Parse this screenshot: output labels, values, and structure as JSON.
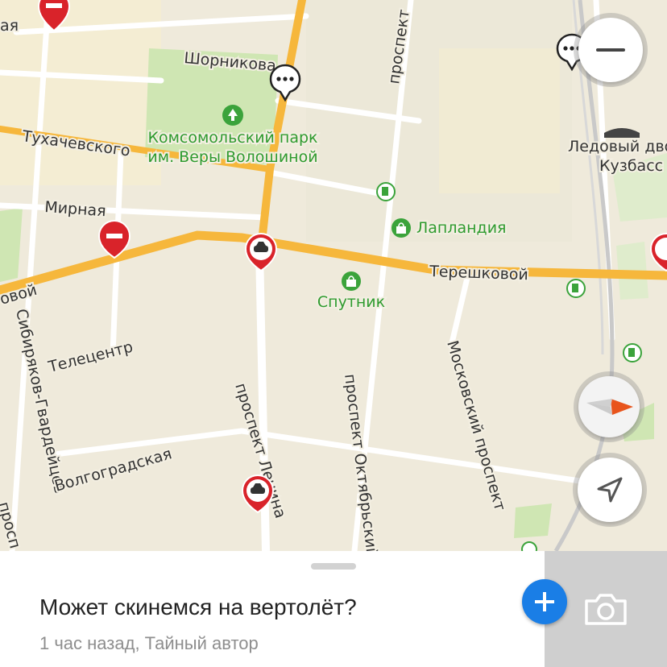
{
  "map": {
    "streets": {
      "shornikova": "Шорникова",
      "tukhachevskogo": "Тухачевского",
      "mirnaya": "Мирная",
      "tereshkovoy": "Терешковой",
      "ovoy": "овой",
      "telecentr": "Телецентр",
      "sibiryakov": "Сибиряков-Гвардейцев",
      "volgogradskaya": "Волгоградская",
      "prospekt_lenina": "проспект Ленина",
      "prospekt_oktyabrsky": "проспект Октябрьский",
      "moskovsky_prospekt": "Московский проспект",
      "prospekt_top": "проспект",
      "prosp_left": "просп",
      "aya": "ая"
    },
    "pois": {
      "park_line1": "Комсомольский парк",
      "park_line2": "им. Веры Волошиной",
      "laplandiya": "Лапландия",
      "sputnik": "Спутник",
      "ice_palace_line1": "Ледовый двор",
      "ice_palace_line2": "Кузбасс"
    },
    "colors": {
      "main_road": "#f6b73c",
      "poi_text": "#2f9b2f",
      "incident_red": "#d9232a"
    }
  },
  "controls": {
    "zoom_out_icon": "minus-icon",
    "compass_icon": "compass-icon",
    "locate_icon": "navigation-arrow-icon"
  },
  "sheet": {
    "title": "Может скинемся на вертолёт?",
    "meta": "1 час назад, Тайный автор",
    "add_icon": "plus-icon",
    "camera_icon": "camera-icon",
    "accent": "#1a7ee6"
  }
}
